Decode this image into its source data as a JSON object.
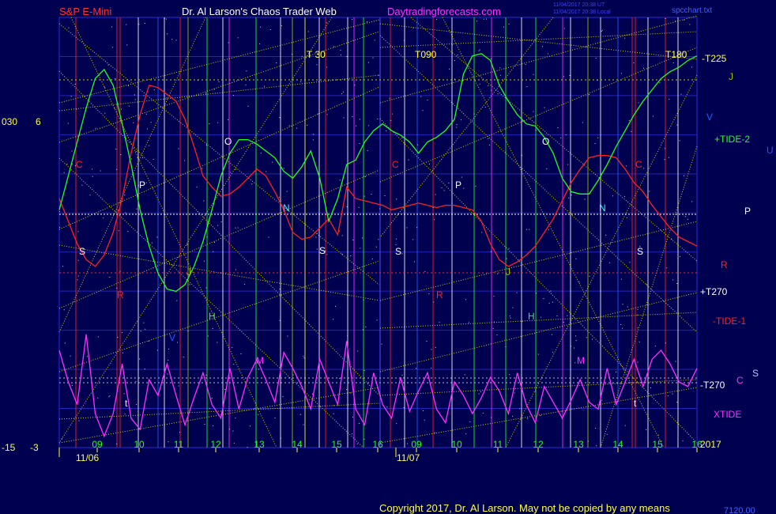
{
  "header": {
    "left_title": "S&P E-Mini",
    "center_title": "Dr. Al Larson's Chaos Trader Web",
    "site": "Daytradingforecasts.com",
    "stamp_line1": "11/04/2017 20:38 UT",
    "stamp_line2": "11/04/2017 20:38 Local",
    "file_name": "spcchart.txt"
  },
  "footer": {
    "copyright": "Copyright 2017, Dr. Al Larson. May not be copied by any means",
    "base_value": "7120.00",
    "end_year": "2017"
  },
  "left_axis": {
    "label_030": "030",
    "label_6": "6",
    "label_m15": "-15",
    "label_m3": "-3"
  },
  "colors": {
    "background": "#000050",
    "grid": "#2d2dd8",
    "price_line": "#ff2020",
    "tide2_line": "#20ff20",
    "xtide_line": "#ff30ff",
    "gann_lines": "#e8e800",
    "dots": "#ffffff"
  },
  "chart_data": {
    "type": "line",
    "title": "S&P E-Mini",
    "x_tick_labels": [
      "09",
      "10",
      "11",
      "12",
      "13",
      "14",
      "15",
      "16",
      "09",
      "10",
      "11",
      "12",
      "13",
      "14",
      "15",
      "16"
    ],
    "date_labels": [
      "11/06",
      "11/07"
    ],
    "right_labels": {
      "t225": "-T225",
      "j": "J",
      "v": "V",
      "tide2": "+TIDE-2",
      "u": "U",
      "p": "P",
      "r": "R",
      "t270_plus": "+T270",
      "tide1": "-TIDE-1",
      "t270_minus": "-T270",
      "c": "C",
      "s": "S",
      "xtide": "XTIDE"
    },
    "top_labels": {
      "t030": "T 30",
      "t090": "T090",
      "t180": "T180"
    },
    "planet_letters": [
      "C",
      "P",
      "O",
      "S",
      "R",
      "J",
      "H",
      "V",
      "M",
      "t",
      "N",
      "S",
      "C",
      "P",
      "O",
      "N",
      "S",
      "C",
      "R",
      "J",
      "H",
      "M",
      "t",
      "S"
    ],
    "series": [
      {
        "name": "-TIDE-1",
        "color": "#ff2020",
        "values": [
          -1.5,
          -2.5,
          -3.5,
          -4.2,
          -4.5,
          -4.0,
          -3.0,
          -1.5,
          0.5,
          2.2,
          3.5,
          3.4,
          3.1,
          2.8,
          2.0,
          0.8,
          -0.5,
          -1.0,
          -1.4,
          -1.3,
          -1.0,
          -0.6,
          -0.2,
          -0.5,
          -1.2,
          -2.0,
          -3.0,
          -3.3,
          -3.2,
          -2.8,
          -2.4,
          -3.1,
          -1.0,
          -1.5,
          -1.6,
          -1.7,
          -1.8,
          -2.0,
          -1.9,
          -1.8,
          -1.7,
          -1.8,
          -1.9,
          -1.8,
          -1.8,
          -1.9,
          -2.0,
          -2.5,
          -3.5,
          -4.2,
          -4.5,
          -4.3,
          -4.0,
          -3.6,
          -3.0,
          -2.4,
          -1.6,
          -0.8,
          -0.2,
          0.3,
          0.4,
          0.4,
          0.3,
          -0.2,
          -0.8,
          -1.2,
          -1.8,
          -2.3,
          -2.8,
          -3.2,
          -3.4,
          -3.6
        ]
      },
      {
        "name": "+TIDE-2",
        "color": "#20ff20",
        "values": [
          -2.0,
          -0.5,
          1.0,
          2.5,
          3.8,
          4.2,
          3.5,
          1.8,
          0.0,
          -2.0,
          -3.6,
          -4.8,
          -5.5,
          -5.6,
          -5.3,
          -4.5,
          -3.4,
          -2.0,
          -0.5,
          0.5,
          1.1,
          1.1,
          0.9,
          0.6,
          0.3,
          -0.3,
          -0.6,
          -0.1,
          0.6,
          -0.6,
          -2.5,
          -1.5,
          0.0,
          0.2,
          1.0,
          1.5,
          1.8,
          1.5,
          1.3,
          1.0,
          0.5,
          1.0,
          1.2,
          1.5,
          2.0,
          4.0,
          4.8,
          4.9,
          4.6,
          3.5,
          2.8,
          2.2,
          1.8,
          1.7,
          1.2,
          0.5,
          -0.6,
          -1.2,
          -1.3,
          -1.3,
          -0.7,
          0.0,
          0.8,
          1.5,
          2.2,
          2.8,
          3.3,
          3.8,
          4.1,
          4.3,
          4.6,
          4.8
        ]
      },
      {
        "name": "XTIDE",
        "color": "#ff30ff",
        "values": [
          -8.2,
          -9.6,
          -10.6,
          -7.5,
          -11.0,
          -12.0,
          -11.0,
          -8.8,
          -11.2,
          -11.7,
          -9.5,
          -10.2,
          -8.8,
          -10.2,
          -11.5,
          -10.3,
          -9.2,
          -10.6,
          -11.2,
          -9.0,
          -10.8,
          -9.4,
          -8.6,
          -9.5,
          -10.5,
          -8.3,
          -9.0,
          -9.8,
          -10.8,
          -8.6,
          -9.6,
          -10.6,
          -7.8,
          -10.8,
          -11.5,
          -9.2,
          -10.6,
          -11.2,
          -9.4,
          -10.9,
          -10.0,
          -9.2,
          -10.8,
          -11.4,
          -9.6,
          -10.2,
          -11.0,
          -10.3,
          -9.4,
          -10.0,
          -11.0,
          -9.2,
          -10.6,
          -11.4,
          -9.8,
          -10.5,
          -11.2,
          -10.4,
          -9.5,
          -10.5,
          -10.8,
          -9.0,
          -10.6,
          -9.6,
          -8.6,
          -9.8,
          -8.6,
          -8.2,
          -8.8,
          -9.6,
          -9.8,
          -9.0
        ]
      }
    ],
    "y_range": [
      -12.5,
      6.5
    ],
    "grid": "on",
    "legend": "right"
  }
}
